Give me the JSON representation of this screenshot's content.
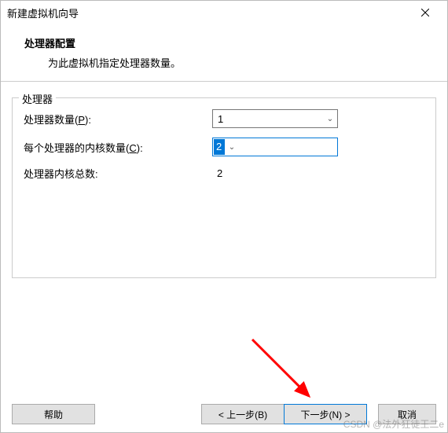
{
  "window": {
    "title": "新建虚拟机向导"
  },
  "header": {
    "title": "处理器配置",
    "description": "为此虚拟机指定处理器数量。"
  },
  "group": {
    "title": "处理器",
    "fields": {
      "processors": {
        "label_pre": "处理器数量(",
        "hotkey": "P",
        "label_post": "):",
        "value": "1"
      },
      "cores": {
        "label_pre": "每个处理器的内核数量(",
        "hotkey": "C",
        "label_post": "):",
        "value": "2"
      },
      "total": {
        "label": "处理器内核总数:",
        "value": "2"
      }
    }
  },
  "buttons": {
    "help": "帮助",
    "prev": "< 上一步(B)",
    "next": "下一步(N) >",
    "cancel": "取消"
  },
  "watermark": "CSDN @法外狂徒王二e"
}
